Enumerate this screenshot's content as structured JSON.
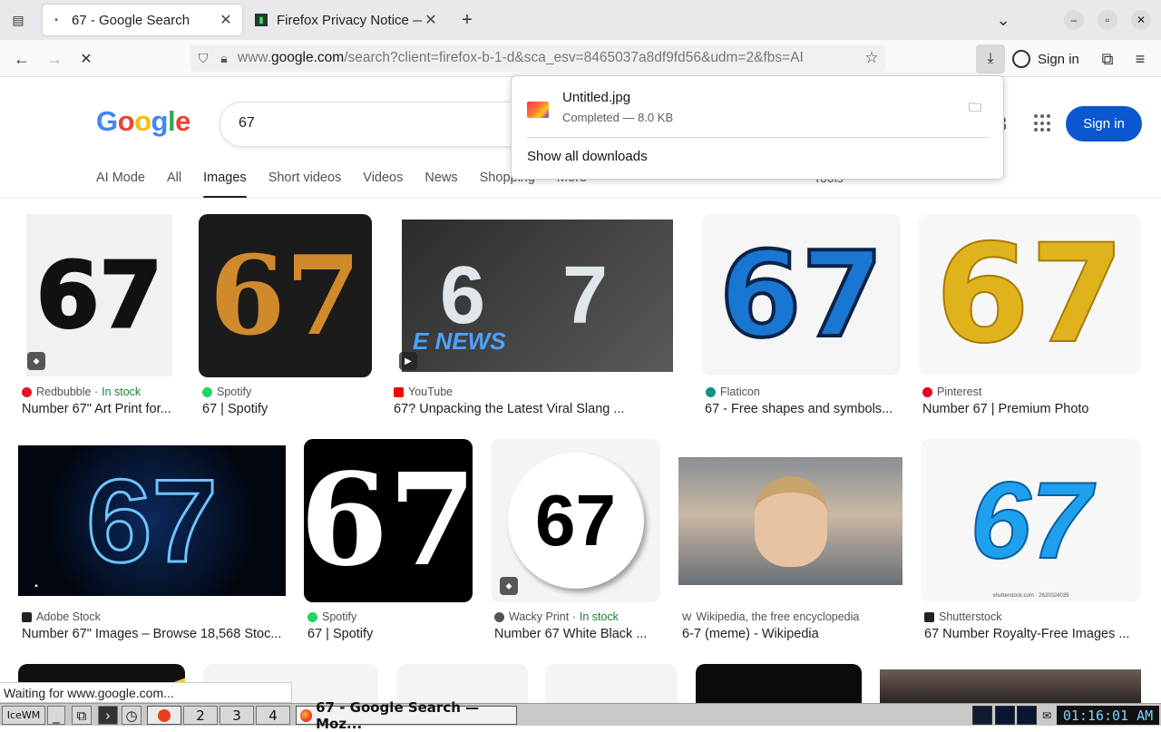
{
  "browser": {
    "tabs": [
      {
        "title": "67 - Google Search",
        "active": true
      },
      {
        "title": "Firefox Privacy Notice —",
        "active": false
      }
    ],
    "url_prefix": "www.",
    "url_host": "google.com",
    "url_path": "/search?client=firefox-b-1-d&sca_esv=8465037a8df9fd56&udm=2&fbs=AI",
    "signin_label": "Sign in"
  },
  "downloads": {
    "file_name": "Untitled.jpg",
    "status": "Completed — 8.0 KB",
    "show_all": "Show all downloads"
  },
  "google": {
    "query": "67",
    "signin_label": "Sign in",
    "tabs": [
      "AI Mode",
      "All",
      "Images",
      "Short videos",
      "Videos",
      "News",
      "Shopping",
      "More"
    ],
    "active_tab": "Images",
    "tools_label": "Tools"
  },
  "results": [
    {
      "source": "Redbubble",
      "stock": "In stock",
      "caption": "Number 67\" Art Print for...",
      "thumb_text": "67",
      "src_color": "#e41321"
    },
    {
      "source": "Spotify",
      "stock": "",
      "caption": "67 | Spotify",
      "thumb_text": "67",
      "src_color": "#1ed760"
    },
    {
      "source": "YouTube",
      "stock": "",
      "caption": "67? Unpacking the Latest Viral Slang ...",
      "thumb_text": "6 7",
      "src_color": "#ff0000",
      "overlay": "E NEWS"
    },
    {
      "source": "Flaticon",
      "stock": "",
      "caption": "67 - Free shapes and symbols...",
      "thumb_text": "67",
      "src_color": "#0d9488"
    },
    {
      "source": "Pinterest",
      "stock": "",
      "caption": "Number 67 | Premium Photo",
      "thumb_text": "67",
      "src_color": "#e60023"
    },
    {
      "source": "Adobe Stock",
      "stock": "",
      "caption": "Number 67\" Images – Browse 18,568 Stoc...",
      "thumb_text": "67",
      "src_color": "#222222"
    },
    {
      "source": "Spotify",
      "stock": "",
      "caption": "67 | Spotify",
      "thumb_text": "67",
      "src_color": "#1ed760"
    },
    {
      "source": "Wacky Print",
      "stock": "In stock",
      "caption": "Number 67 White Black ...",
      "thumb_text": "67",
      "src_color": "#555555"
    },
    {
      "source": "Wikipedia, the free encyclopedia",
      "stock": "",
      "caption": "6-7 (meme) - Wikipedia",
      "thumb_text": "",
      "src_color": "#444444"
    },
    {
      "source": "Shutterstock",
      "stock": "",
      "caption": "67 Number Royalty-Free Images ...",
      "thumb_text": "67",
      "src_color": "#222222",
      "overlay": "shutterstock.com · 2620024039"
    }
  ],
  "status_text": "Waiting for www.google.com...",
  "taskbar": {
    "workspaces": [
      "1",
      "2",
      "3",
      "4"
    ],
    "task_title": "67 - Google Search — Moz...",
    "clock": "01:16:01 AM"
  }
}
